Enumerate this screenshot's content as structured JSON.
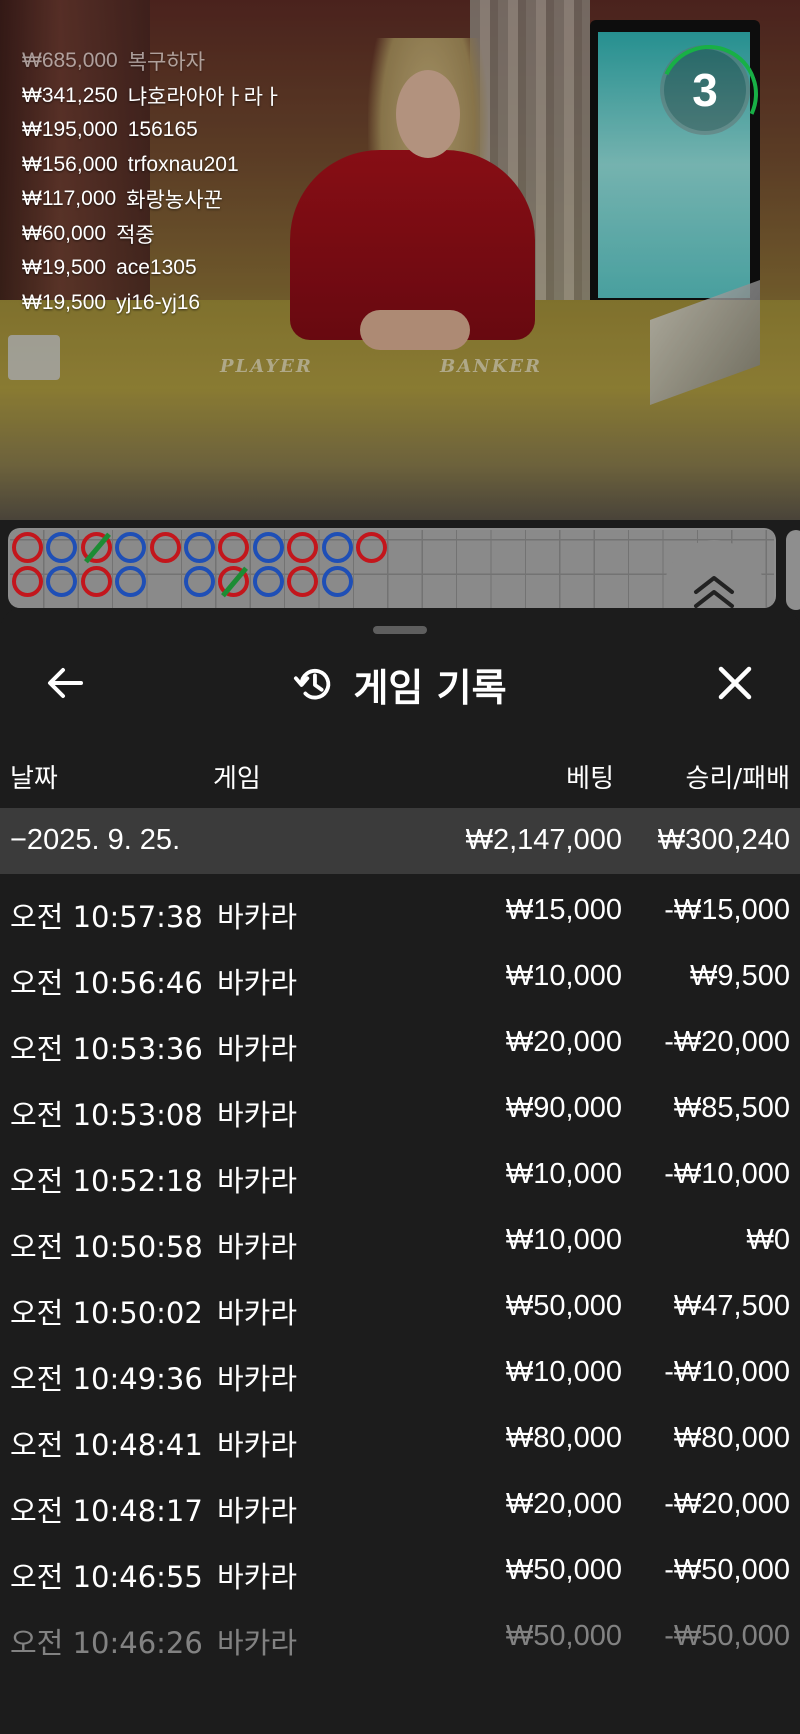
{
  "video": {
    "countdown": "3",
    "table_labels": {
      "player": "PLAYER",
      "banker": "BANKER"
    },
    "winners": [
      {
        "amount": "₩685,000",
        "name": "복구하자"
      },
      {
        "amount": "₩341,250",
        "name": "냐호라아아ㅏ라ㅏ"
      },
      {
        "amount": "₩195,000",
        "name": "156165"
      },
      {
        "amount": "₩156,000",
        "name": "trfoxnau201"
      },
      {
        "amount": "₩117,000",
        "name": "화랑농사꾼"
      },
      {
        "amount": "₩60,000",
        "name": "적중"
      },
      {
        "amount": "₩19,500",
        "name": "ace1305"
      },
      {
        "amount": "₩19,500",
        "name": "yj16-yj16"
      }
    ]
  },
  "roadmap": {
    "colors": {
      "player": "#1f4fb6",
      "banker": "#c3161c",
      "tie": "#1c8c34"
    },
    "row1": [
      "b",
      "p",
      "b-tie",
      "p",
      "b",
      "p",
      "b",
      "p",
      "b",
      "p",
      "b"
    ],
    "row2": [
      "b",
      "p",
      "b",
      "p",
      "",
      "p",
      "b-tie",
      "p",
      "b",
      "p"
    ]
  },
  "sheet": {
    "title": "게임 기록",
    "icons": {
      "back": "arrow-left-icon",
      "history": "history-icon",
      "close": "close-icon",
      "scroll_up": "double-chevron-up-icon"
    },
    "columns": {
      "date": "날짜",
      "game": "게임",
      "bet": "베팅",
      "result": "승리/패배"
    },
    "date_group": {
      "label": "−2025. 9. 25.",
      "bet_total": "₩2,147,000",
      "result_total": "₩300,240"
    },
    "rows": [
      {
        "time": "오전 10:57:38",
        "game": "바카라",
        "bet": "₩15,000",
        "result": "-₩15,000"
      },
      {
        "time": "오전 10:56:46",
        "game": "바카라",
        "bet": "₩10,000",
        "result": "₩9,500"
      },
      {
        "time": "오전 10:53:36",
        "game": "바카라",
        "bet": "₩20,000",
        "result": "-₩20,000"
      },
      {
        "time": "오전 10:53:08",
        "game": "바카라",
        "bet": "₩90,000",
        "result": "₩85,500"
      },
      {
        "time": "오전 10:52:18",
        "game": "바카라",
        "bet": "₩10,000",
        "result": "-₩10,000"
      },
      {
        "time": "오전 10:50:58",
        "game": "바카라",
        "bet": "₩10,000",
        "result": "₩0"
      },
      {
        "time": "오전 10:50:02",
        "game": "바카라",
        "bet": "₩50,000",
        "result": "₩47,500"
      },
      {
        "time": "오전 10:49:36",
        "game": "바카라",
        "bet": "₩10,000",
        "result": "-₩10,000"
      },
      {
        "time": "오전 10:48:41",
        "game": "바카라",
        "bet": "₩80,000",
        "result": "₩80,000"
      },
      {
        "time": "오전 10:48:17",
        "game": "바카라",
        "bet": "₩20,000",
        "result": "-₩20,000"
      },
      {
        "time": "오전 10:46:55",
        "game": "바카라",
        "bet": "₩50,000",
        "result": "-₩50,000"
      },
      {
        "time": "오전 10:46:26",
        "game": "바카라",
        "bet": "₩50,000",
        "result": "-₩50,000"
      }
    ]
  }
}
